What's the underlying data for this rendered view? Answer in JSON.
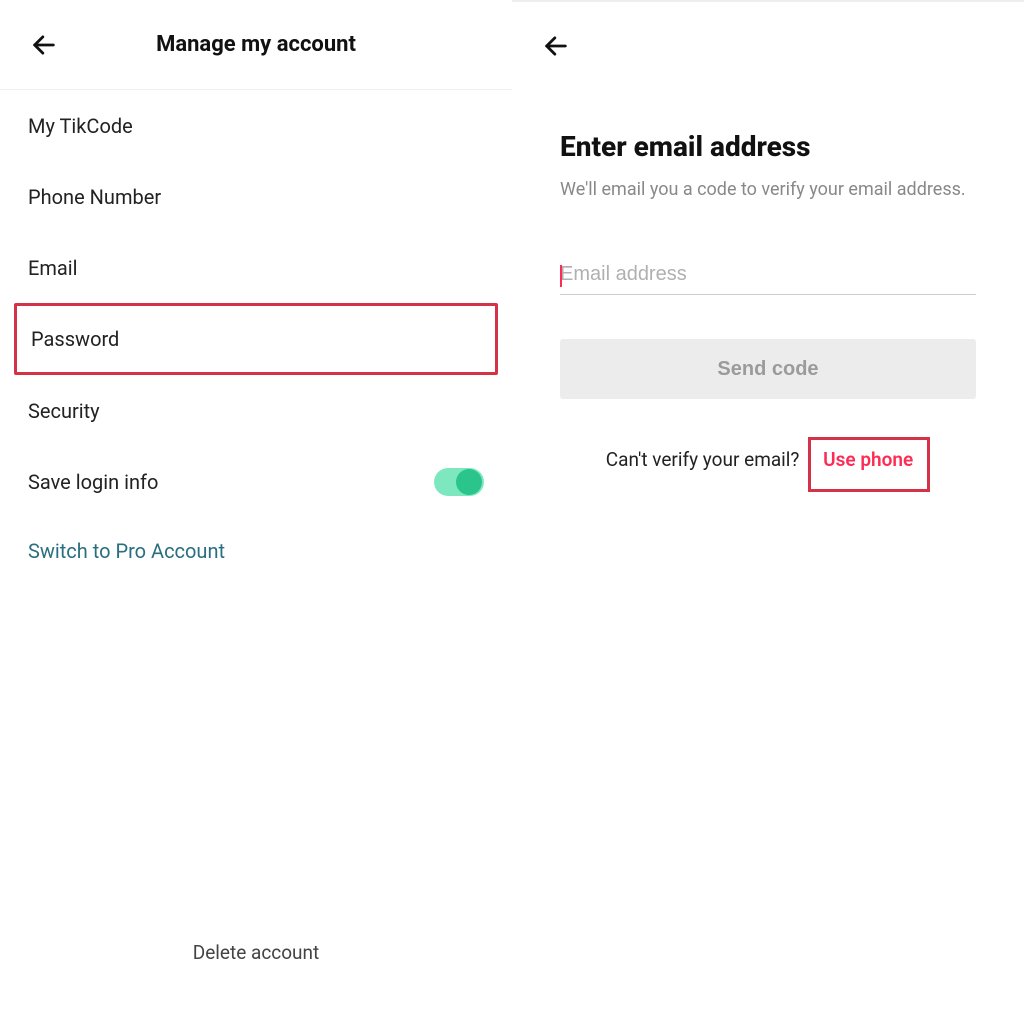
{
  "left": {
    "header_title": "Manage my account",
    "items": {
      "tikcode": "My TikCode",
      "phone": "Phone Number",
      "email": "Email",
      "password": "Password",
      "security": "Security",
      "savelogin": "Save login info"
    },
    "switch_pro": "Switch to Pro Account",
    "delete_account": "Delete account"
  },
  "right": {
    "heading": "Enter email address",
    "subtext": "We'll email you a code to verify your email address.",
    "placeholder": "Email address",
    "send_label": "Send code",
    "verify_prefix": "Can't verify your email? ",
    "use_phone": "Use phone"
  }
}
